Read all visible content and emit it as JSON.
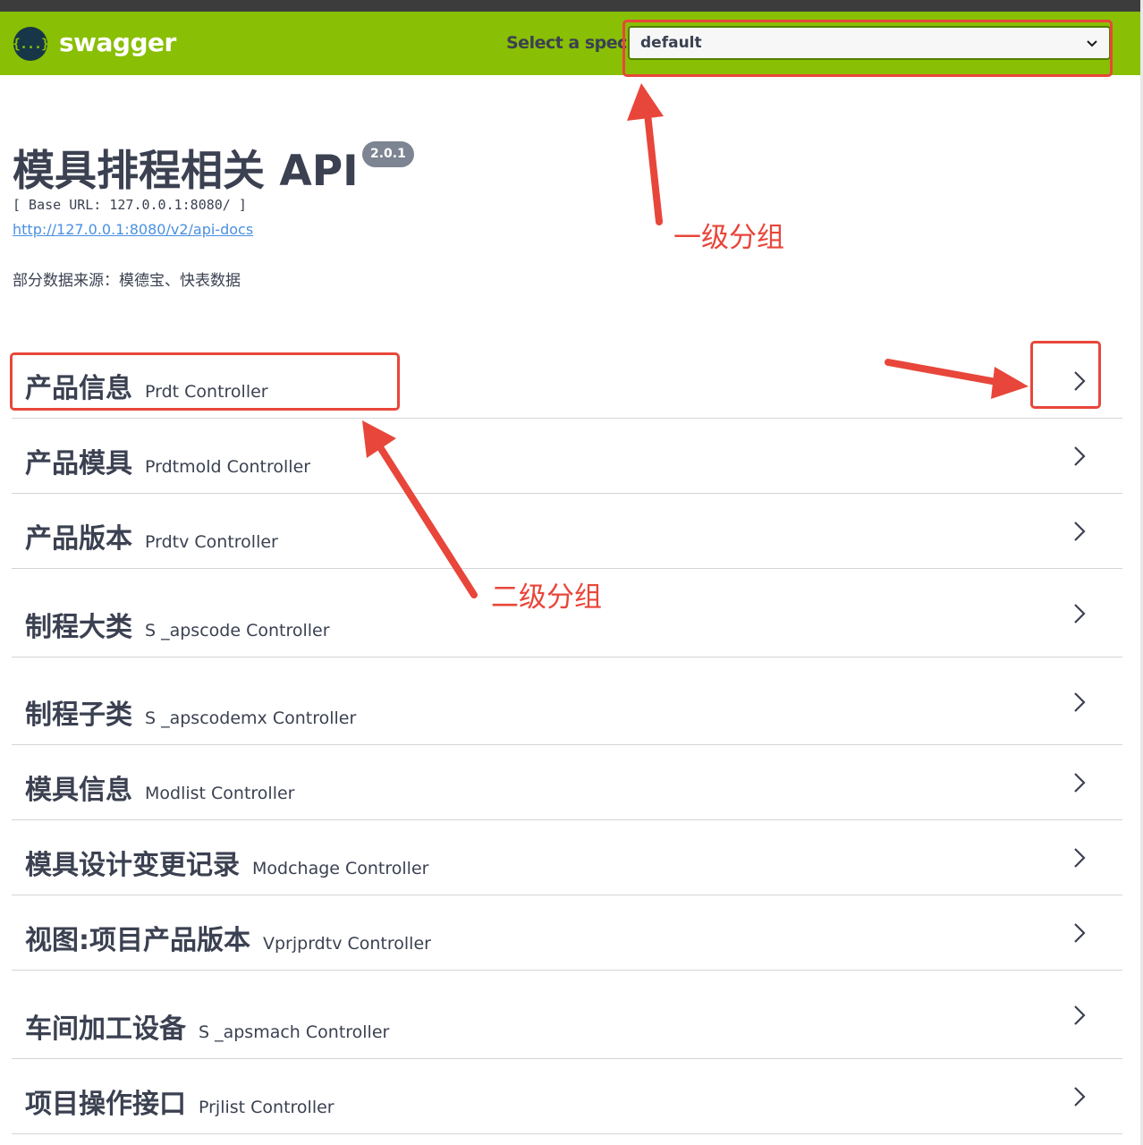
{
  "header": {
    "logo_glyph": "{...}",
    "logo_text": "swagger",
    "spec_label": "Select a spec",
    "spec_value": "default",
    "bg_color": "#89bf04"
  },
  "info": {
    "title": "模具排程相关 API",
    "version": "2.0.1",
    "base_url": "[ Base URL: 127.0.0.1:8080/ ]",
    "docs_link": "http://127.0.0.1:8080/v2/api-docs",
    "description": "部分数据来源：模德宝、快表数据"
  },
  "tags": [
    {
      "name": "产品信息",
      "description": "Prdt Controller"
    },
    {
      "name": "产品模具",
      "description": "Prdtmold Controller"
    },
    {
      "name": "产品版本",
      "description": "Prdtv Controller"
    },
    {
      "name": "制程大类",
      "description": "S _apscode Controller"
    },
    {
      "name": "制程子类",
      "description": "S _apscodemx Controller"
    },
    {
      "name": "模具信息",
      "description": "Modlist Controller"
    },
    {
      "name": "模具设计变更记录",
      "description": "Modchage Controller"
    },
    {
      "name": "视图:项目产品版本",
      "description": "Vprjprdtv Controller"
    },
    {
      "name": "车间加工设备",
      "description": "S _apsmach Controller"
    },
    {
      "name": "项目操作接口",
      "description": "Prjlist Controller"
    }
  ],
  "annotations": {
    "level1_label": "一级分组",
    "level2_label": "二级分组",
    "color": "#e8463a"
  }
}
